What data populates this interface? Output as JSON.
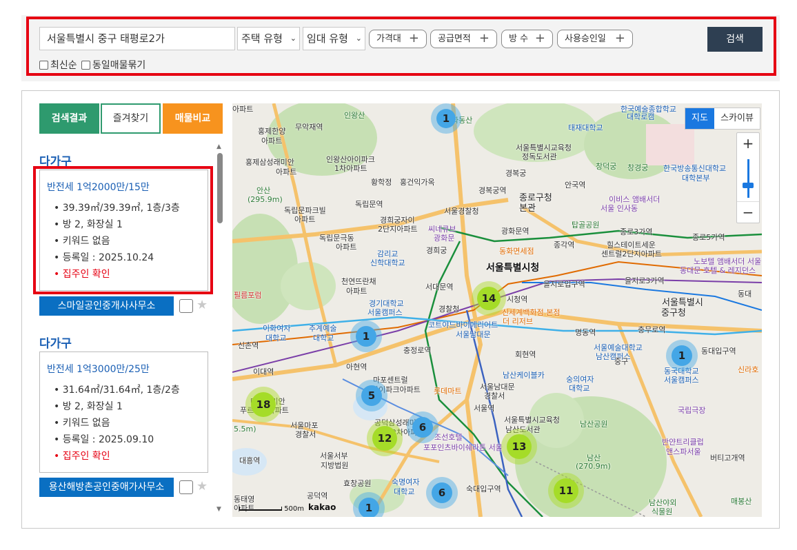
{
  "search": {
    "address": "서울특별시 중구 태평로2가",
    "housing_type": "주택 유형",
    "lease_type": "임대 유형",
    "filters": [
      "가격대",
      "공급면적",
      "방 수",
      "사용승인일"
    ],
    "search_label": "검색",
    "checkboxes": [
      "최신순",
      "동일매물묶기"
    ]
  },
  "tabs": [
    "검색결과",
    "즐겨찾기",
    "매물비교"
  ],
  "listings": [
    {
      "title": "다가구",
      "price": "반전세 1억2000만/15만",
      "area": "39.39㎡/39.39㎡, 1층/3층",
      "rooms": "방 2, 화장실 1",
      "keywords": "키워드 없음",
      "registered": "등록일 : 2025.10.24",
      "status": "집주인 확인",
      "agent": "스마일공인중개사사무소"
    },
    {
      "title": "다가구",
      "price": "반전세 1억3000만/25만",
      "area": "31.64㎡/31.64㎡, 1층/2층",
      "rooms": "방 2, 화장실 1",
      "keywords": "키워드 없음",
      "registered": "등록일 : 2025.09.10",
      "status": "집주인 확인",
      "agent": "용산해방촌공인중애가사무소"
    }
  ],
  "map": {
    "type_map": "지도",
    "type_sky": "스카이뷰",
    "zoom_in": "+",
    "zoom_out": "−",
    "scale": "500m",
    "brand": "kakao",
    "clusters": [
      {
        "count": "1",
        "color": "blue"
      },
      {
        "count": "14",
        "color": "green"
      },
      {
        "count": "1",
        "color": "blue"
      },
      {
        "count": "1",
        "color": "blue"
      },
      {
        "count": "18",
        "color": "green"
      },
      {
        "count": "5",
        "color": "blue"
      },
      {
        "count": "12",
        "color": "green"
      },
      {
        "count": "6",
        "color": "blue"
      },
      {
        "count": "13",
        "color": "green"
      },
      {
        "count": "6",
        "color": "blue"
      },
      {
        "count": "11",
        "color": "green"
      },
      {
        "count": "1",
        "color": "blue"
      }
    ],
    "labels": {
      "l01": "아파트",
      "l02": "인왕산",
      "l03": "무악재역",
      "l04": "홍제한양",
      "l05": "아파트",
      "l06": "홍제삼성래미안",
      "l07": "아파트",
      "l08": "인왕산아이파크",
      "l09": "1차아파트",
      "l10": "안산",
      "l11": "(295.9m)",
      "l12": "독립문파크빌",
      "l13": "아파트",
      "l14": "황학정",
      "l15": "홍건익가옥",
      "l16": "독립문역",
      "l17": "경희궁자이",
      "l18": "2단지아파트",
      "l19": "독립문극동",
      "l20": "아파트",
      "l21": "감리교",
      "l22": "신학대학교",
      "l23": "천연뜨란채",
      "l24": "아파트",
      "l25": "서대문역",
      "l26": "경기대학교",
      "l27": "서울캠퍼스",
      "l28": "필름포럼",
      "l29": "이화여자",
      "l30": "대학교",
      "l31": "추계예술",
      "l32": "대학교",
      "l33": "신촌역",
      "l34": "아현역",
      "l35": "이대역",
      "l36": "마포래미안",
      "l37": "푸르지오아파트",
      "l38": "서울마포",
      "l39": "경찰서",
      "l40": "대흥역",
      "l41": "서울서부",
      "l42": "지방법원",
      "l43": "효창공원",
      "l44": "숙명여자",
      "l45": "대학교",
      "l46": "공덕역",
      "l47": "동태영",
      "l48": "아파트",
      "l49": "화동산",
      "l50": "서울특별시교육청",
      "l51": "정독도서관",
      "l52": "경복궁",
      "l53": "경복궁역",
      "l54": "종로구청",
      "l55": "본관",
      "l56": "서울경찰청",
      "l57": "씨네큐브",
      "l58": "광화문",
      "l59": "광화문역",
      "l60": "경희궁",
      "l61": "동화면세점",
      "l62": "서울특별시청",
      "l63": "시청역",
      "l64": "을지로입구역",
      "l65": "경찰청",
      "l66": "코트야드바이메리어트",
      "l67": "서울남대문",
      "l68": "충정로역",
      "l69": "마포센트럴",
      "l70": "아이파크아파트",
      "l71": "공덕삼성래미안",
      "l72": "2차아파트",
      "l73": "포포인츠바이쉐라톤 서울",
      "l74": "서울남대문",
      "l75": "경찰서",
      "l76": "서울역",
      "l77": "롯데마트",
      "l78": "숙대입구역",
      "l79": "조선호텔",
      "l80": "태재대학교",
      "l81": "안국역",
      "l82": "창덕궁",
      "l83": "창경궁",
      "l84": "이비스 앰배서더",
      "l85": "서울 인사동",
      "l86": "탑골공원",
      "l87": "종로3가역",
      "l88": "종각역",
      "l89": "힐스테이트세운",
      "l90": "센트럴2단지아파트",
      "l91": "종로5가역",
      "l92": "을지로3가역",
      "l93": "서울특별시",
      "l94": "중구청",
      "l95": "신세계백화점 본점",
      "l96": "더 리저브",
      "l97": "명동역",
      "l98": "충무로역",
      "l99": "회현역",
      "l100": "서울예술대학교",
      "l101": "남산캠퍼스",
      "l102": "남산케이블카",
      "l103": "숭의여자",
      "l104": "대학교",
      "l105": "서울특별시교육청",
      "l106": "남산도서관",
      "l107": "남산공원",
      "l108": "남산",
      "l109": "(270.9m)",
      "l110": "한국방송통신대학교",
      "l111": "대학본부",
      "l112": "노보텔 앰배서더 서울",
      "l113": "동대문 호텔 & 레지던스",
      "l114": "동대문",
      "l115": "동대입구역",
      "l116": "동국대학교",
      "l117": "서울캠퍼스",
      "l118": "신라호",
      "l119": "국립극장",
      "l120": "반얀트리클럽",
      "l121": "앤스파서울",
      "l122": "버티고개역",
      "l123": "매봉산",
      "l124": "남산야외",
      "l125": "식물원",
      "l126": "한국예술종합학교",
      "l127": "대학로캠",
      "l128": "5.5m)",
      "l129": "중구",
      "l130": "종로3가역",
      "l131": "동대"
    }
  },
  "colors": {
    "accent_red": "#e60012",
    "brand_green": "#2e9a6e",
    "brand_orange": "#f7931e",
    "navy": "#2e3f52",
    "link_blue": "#1a5fb4",
    "agent_blue": "#0a6fc2"
  }
}
